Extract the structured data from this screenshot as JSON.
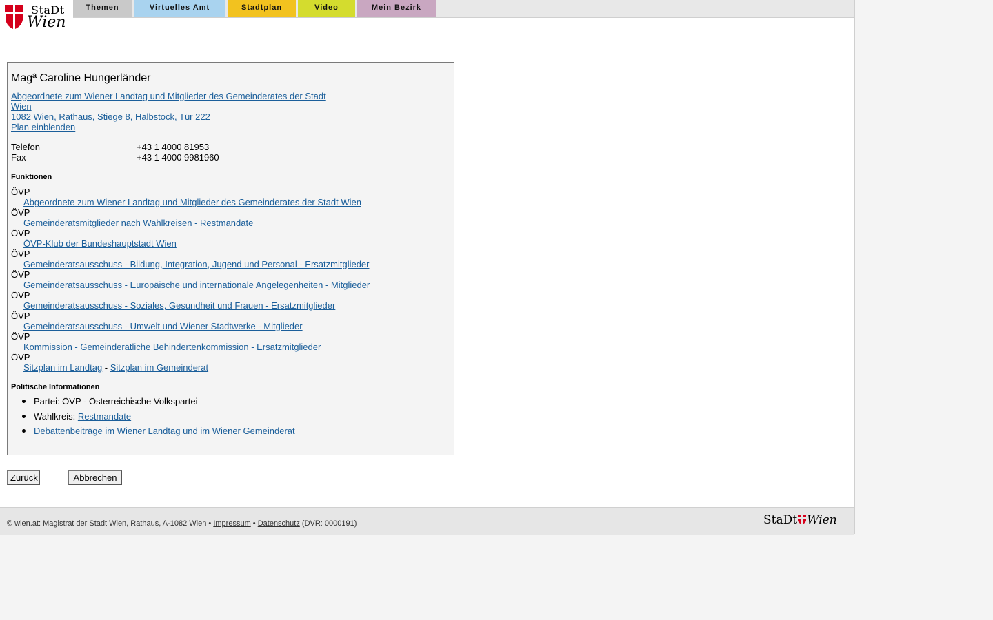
{
  "header": {
    "logo": {
      "line1": "StaDt",
      "line2": "Wien"
    },
    "tabs": [
      {
        "label": "Themen",
        "color": "#c9c9c9"
      },
      {
        "label": "Virtuelles Amt",
        "color": "#a9d3ef"
      },
      {
        "label": "Stadtplan",
        "color": "#f2c21f"
      },
      {
        "label": "Video",
        "color": "#d4dc2e"
      },
      {
        "label": "Mein Bezirk",
        "color": "#c9a7c1"
      }
    ]
  },
  "person": {
    "name": "Magª Caroline Hungerländer",
    "role_link_line1": "Abgeordnete zum Wiener Landtag und Mitglieder des Gemeinderates der Stadt",
    "role_link_line2": "Wien ",
    "address": "1082 Wien, Rathaus, Stiege 8, Halbstock, Tür 222",
    "map_link": "Plan einblenden",
    "phone_label": "Telefon",
    "phone_value": "+43 1 4000 81953",
    "fax_label": "Fax",
    "fax_value": "+43 1 4000 9981960"
  },
  "functions": {
    "heading": "Funktionen",
    "items": [
      {
        "party": "ÖVP",
        "link": "Abgeordnete zum Wiener Landtag und Mitglieder des Gemeinderates der Stadt Wien"
      },
      {
        "party": "ÖVP",
        "link": "Gemeinderatsmitglieder nach Wahlkreisen - Restmandate"
      },
      {
        "party": "ÖVP",
        "link": "ÖVP-Klub der Bundeshauptstadt Wien"
      },
      {
        "party": "ÖVP",
        "link": "Gemeinderatsausschuss - Bildung, Integration, Jugend und Personal - Ersatzmitglieder"
      },
      {
        "party": "ÖVP",
        "link": "Gemeinderatsausschuss - Europäische und internationale Angelegenheiten - Mitglieder"
      },
      {
        "party": "ÖVP",
        "link": "Gemeinderatsausschuss - Soziales, Gesundheit und Frauen - Ersatzmitglieder"
      },
      {
        "party": "ÖVP",
        "link": "Gemeinderatsausschuss - Umwelt und Wiener Stadtwerke - Mitglieder"
      },
      {
        "party": "ÖVP",
        "link": "Kommission - Gemeinderätliche Behindertenkommission - Ersatzmitglieder"
      },
      {
        "party": "ÖVP"
      }
    ],
    "seat_link_landtag": "Sitzplan im Landtag",
    "seat_separator": " - ",
    "seat_link_gemeinderat": "Sitzplan im Gemeinderat"
  },
  "political": {
    "heading": "Politische Informationen",
    "party_text": "Partei: ÖVP - Österreichische Volkspartei",
    "district_label": "Wahlkreis: ",
    "district_link": "Restmandate",
    "debates_link": "Debattenbeiträge im Wiener Landtag und im Wiener Gemeinderat"
  },
  "buttons": {
    "back": "Zurück",
    "cancel": "Abbrechen"
  },
  "footer": {
    "copyright": "© wien.at: Magistrat der Stadt Wien, Rathaus, A-1082 Wien • ",
    "imprint": "Impressum",
    "sep": " • ",
    "privacy": "Datenschutz",
    "dvr": " (DVR: 0000191)",
    "logo_left": "StaDt",
    "logo_right": "Wien"
  }
}
